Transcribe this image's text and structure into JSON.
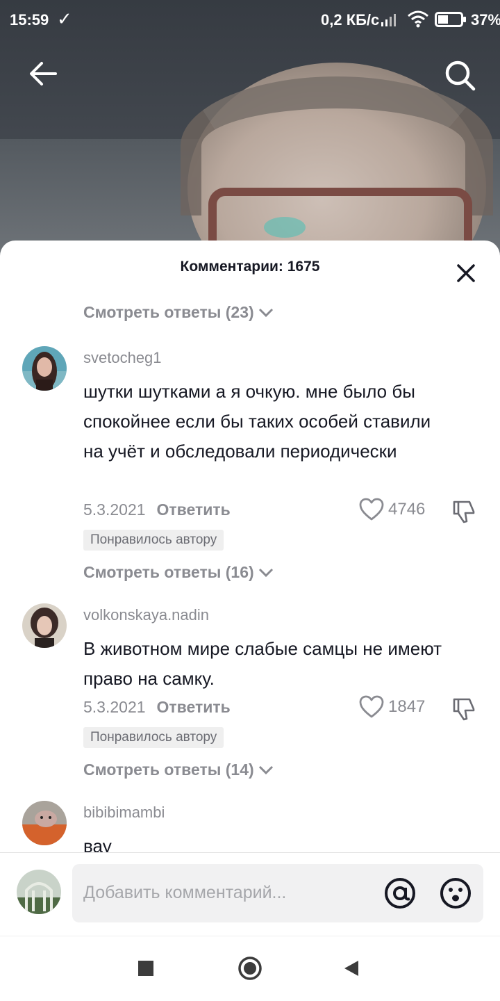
{
  "status_bar": {
    "time": "15:59",
    "network_speed": "0,2 КБ/с",
    "battery_percent": "37%"
  },
  "comments_sheet": {
    "title": "Комментарии: 1675",
    "top_view_replies": "Смотреть ответы (23)",
    "comments": [
      {
        "username": "svetocheg1",
        "text": "шутки шутками а я очкую. мне было бы спокойнее если бы таких особей ставили на учёт и обследовали периодически",
        "date": "5.3.2021",
        "reply_label": "Ответить",
        "likes": "4746",
        "badge": "Понравилось автору",
        "view_replies": "Смотреть ответы (16)"
      },
      {
        "username": "volkonskaya.nadin",
        "text": "В животном мире слабые самцы не имеют право на самку.",
        "date": "5.3.2021",
        "reply_label": "Ответить",
        "likes": "1847",
        "badge": "Понравилось автору",
        "view_replies": "Смотреть ответы (14)"
      },
      {
        "username": "bibibimambi",
        "text": "вау"
      }
    ]
  },
  "input": {
    "placeholder": "Добавить комментарий..."
  },
  "colors": {
    "text_primary": "#161823",
    "text_secondary": "#8a8b91",
    "badge_bg": "#efefef"
  }
}
